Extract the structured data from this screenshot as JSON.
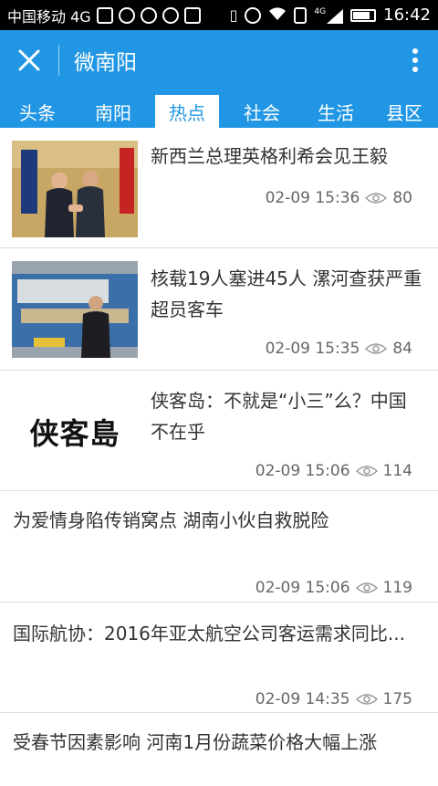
{
  "status": {
    "carrier": "中国移动 4G",
    "network": "4G",
    "time": "16:42"
  },
  "appbar": {
    "title": "微南阳",
    "close_icon": "close-icon",
    "more_icon": "more-vertical-icon"
  },
  "tabs": [
    {
      "label": "头条"
    },
    {
      "label": "南阳"
    },
    {
      "label": "热点"
    },
    {
      "label": "社会"
    },
    {
      "label": "生活"
    },
    {
      "label": "县区"
    }
  ],
  "active_tab": "热点",
  "articles": [
    {
      "title": "新西兰总理英格利希会见王毅",
      "time": "02-09 15:36",
      "views": "80",
      "has_image": true
    },
    {
      "title": "核载19人塞进45人 漯河查获严重超员客车",
      "time": "02-09 15:35",
      "views": "84",
      "has_image": true
    },
    {
      "title": "侠客岛：不就是“小三”么？中国不在乎",
      "time": "02-09 15:06",
      "views": "114",
      "has_image": true,
      "logo_text": "侠客島"
    },
    {
      "title": "为爱情身陷传销窝点 湖南小伙自救脱险",
      "time": "02-09 15:06",
      "views": "119",
      "has_image": false
    },
    {
      "title": "国际航协：2016年亚太航空公司客运需求同比...",
      "time": "02-09 14:35",
      "views": "175",
      "has_image": false
    },
    {
      "title": "受春节因素影响 河南1月份蔬菜价格大幅上涨",
      "has_image": false
    }
  ],
  "colors": {
    "brand": "#2196e4",
    "text": "#333333",
    "meta": "#666666"
  }
}
